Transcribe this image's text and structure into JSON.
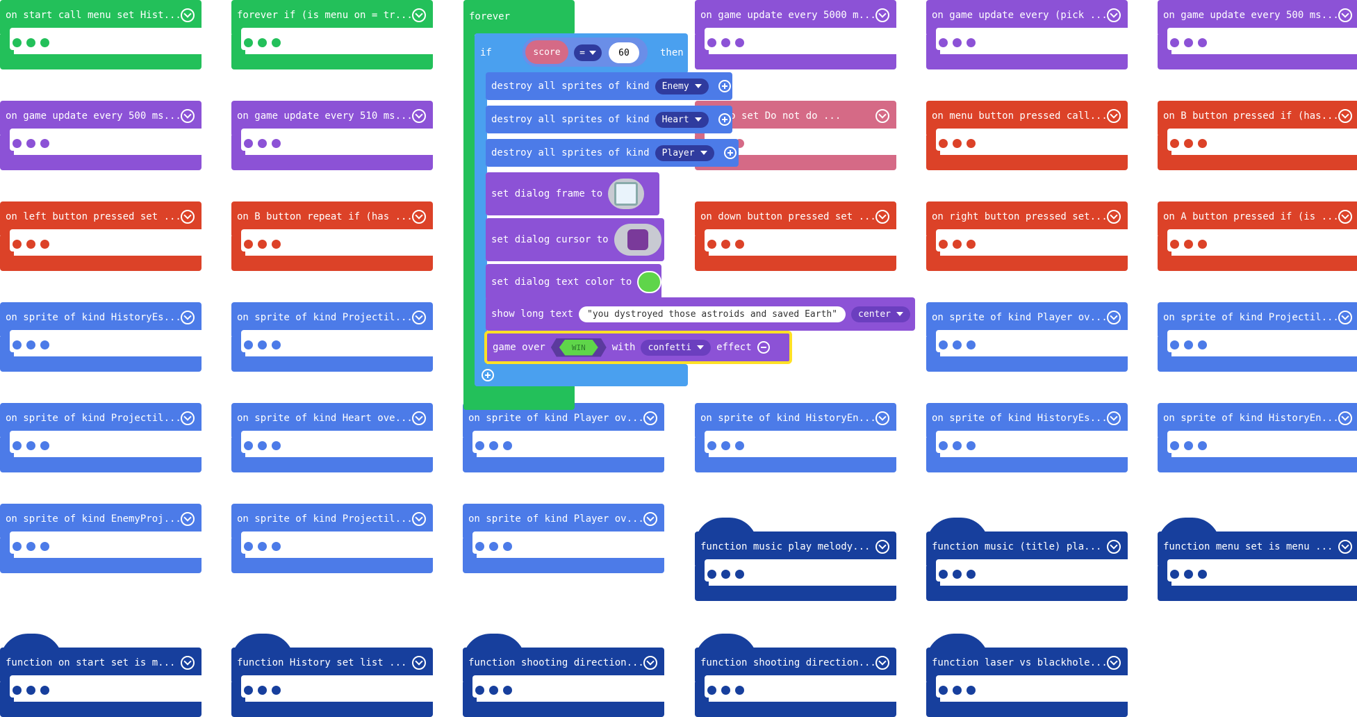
{
  "colors": {
    "green": "#23c05a",
    "purple": "#8c52d6",
    "red": "#dc4228",
    "blue": "#4c7be8",
    "darkblue": "#173f9d",
    "pink": "#d56a86",
    "yellow": "#ffe026",
    "lightblue": "#4aa0ef"
  },
  "blocks": [
    {
      "label": "on start call menu set Hist...",
      "color": "green"
    },
    {
      "label": "forever if (is menu on = tr...",
      "color": "green"
    },
    {
      "label": "on game update every 5000 m...",
      "color": "purple"
    },
    {
      "label": "on game update every (pick ...",
      "color": "purple"
    },
    {
      "label": "on game update every 500 ms...",
      "color": "purple"
    },
    {
      "label": "on game update every 500 ms...",
      "color": "purple"
    },
    {
      "label": "on game update every 510 ms...",
      "color": "purple"
    },
    {
      "label": "e zero set Do not do ...",
      "color": "pink"
    },
    {
      "label": "on menu button pressed call...",
      "color": "red"
    },
    {
      "label": "on B button pressed if (has...",
      "color": "red"
    },
    {
      "label": "on left button pressed set ...",
      "color": "red"
    },
    {
      "label": "on B button repeat if (has ...",
      "color": "red"
    },
    {
      "label": "on down button pressed set ...",
      "color": "red"
    },
    {
      "label": "on right button pressed set...",
      "color": "red"
    },
    {
      "label": "on A button pressed if (is ...",
      "color": "red"
    },
    {
      "label": "on sprite of kind HistoryEs...",
      "color": "blue"
    },
    {
      "label": "on sprite of kind Projectil...",
      "color": "blue"
    },
    {
      "label": "on sprite of kind Player ov...",
      "color": "blue"
    },
    {
      "label": "on sprite of kind Projectil...",
      "color": "blue"
    },
    {
      "label": "on sprite of kind Projectil...",
      "color": "blue"
    },
    {
      "label": "on sprite of kind Heart ove...",
      "color": "blue"
    },
    {
      "label": "on sprite of kind Player ov...",
      "color": "blue"
    },
    {
      "label": "on sprite of kind HistoryEn...",
      "color": "blue"
    },
    {
      "label": "on sprite of kind HistoryEs...",
      "color": "blue"
    },
    {
      "label": "on sprite of kind HistoryEn...",
      "color": "blue"
    },
    {
      "label": "on sprite of kind EnemyProj...",
      "color": "blue"
    },
    {
      "label": "on sprite of kind Projectil...",
      "color": "blue"
    },
    {
      "label": "on sprite of kind Player ov...",
      "color": "blue"
    },
    {
      "label": "function music  play melody...",
      "color": "darkblue",
      "hat": true
    },
    {
      "label": "function music (title)  pla...",
      "color": "darkblue",
      "hat": true
    },
    {
      "label": "function menu  set is menu ...",
      "color": "darkblue",
      "hat": true
    },
    {
      "label": "function on start  set is m...",
      "color": "darkblue",
      "hat": true
    },
    {
      "label": "function History  set list ...",
      "color": "darkblue",
      "hat": true
    },
    {
      "label": "function shooting direction...",
      "color": "darkblue",
      "hat": true
    },
    {
      "label": "function shooting direction...",
      "color": "darkblue",
      "hat": true
    },
    {
      "label": "function laser vs blackhole...",
      "color": "darkblue",
      "hat": true
    }
  ],
  "forever": {
    "label": "forever",
    "if_label": "if",
    "var": "score",
    "op": "=",
    "num": "60",
    "then_label": "then",
    "destroy_text": "destroy all sprites of kind",
    "kinds": [
      "Enemy",
      "Heart",
      "Player"
    ],
    "frame_text": "set dialog frame to",
    "cursor_text": "set dialog cursor to",
    "textcolor_text": "set dialog text color to",
    "show_text": "show long text",
    "message": "you dystroyed those astroids and saved Earth",
    "position": "center",
    "gameover_text": "game over",
    "win": "WIN",
    "with_text": "with",
    "effect": "confetti",
    "effect_text": "effect"
  }
}
